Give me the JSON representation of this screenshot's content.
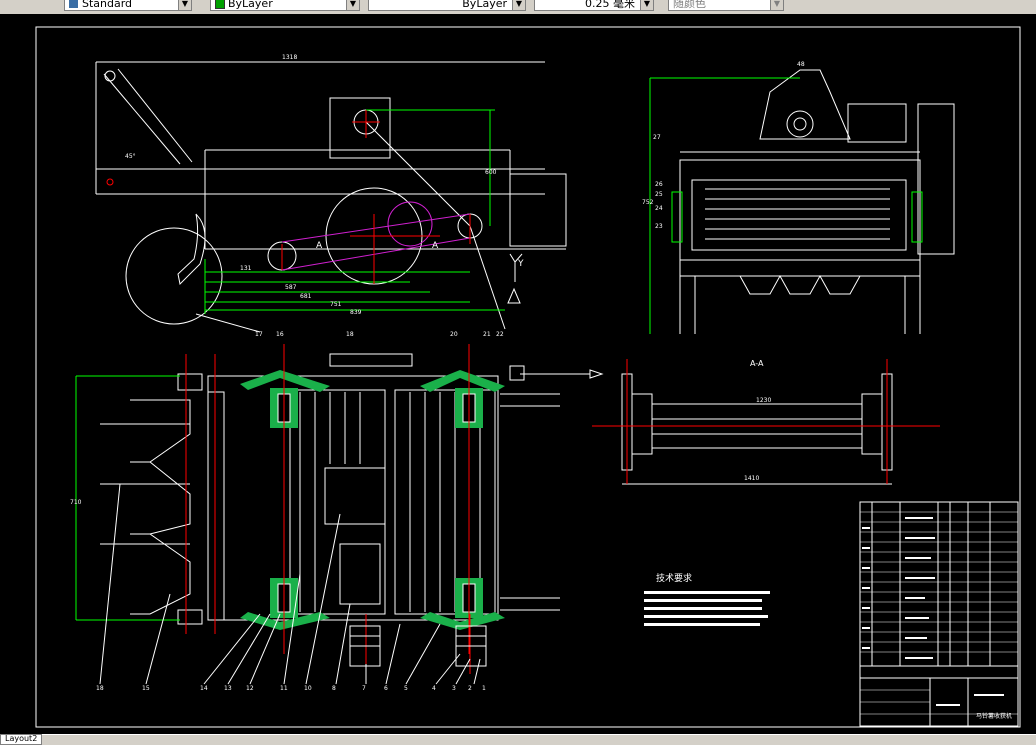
{
  "toolbar": {
    "text_style": "Standard",
    "color": "ByLayer",
    "linetype": "ByLayer",
    "lineweight": "0.25 毫米",
    "plot_style": "随颜色",
    "color_swatch": "#00a000"
  },
  "drawing": {
    "top_view_dims": [
      "1318",
      "600",
      "131",
      "587",
      "681",
      "751",
      "839",
      "430"
    ],
    "angle_label": "45°",
    "section_marks": [
      "A",
      "A",
      "Y"
    ],
    "side_view_dims": [
      "48",
      "27",
      "26",
      "25",
      "24",
      "23",
      "752"
    ],
    "bottom_view_dims": [
      "16",
      "17",
      "18",
      "19",
      "20",
      "21",
      "22",
      "710"
    ],
    "part_numbers": [
      "18",
      "15",
      "14",
      "13",
      "12",
      "11",
      "10",
      "9",
      "8",
      "7",
      "6",
      "5",
      "4",
      "3",
      "2",
      "1"
    ],
    "section_title": "A-A",
    "section_dims": [
      "1230",
      "1410"
    ],
    "notes_title": "技术要求",
    "title_block_name": "马铃薯收获机"
  },
  "status": {
    "layout_tab": "Layout2"
  }
}
